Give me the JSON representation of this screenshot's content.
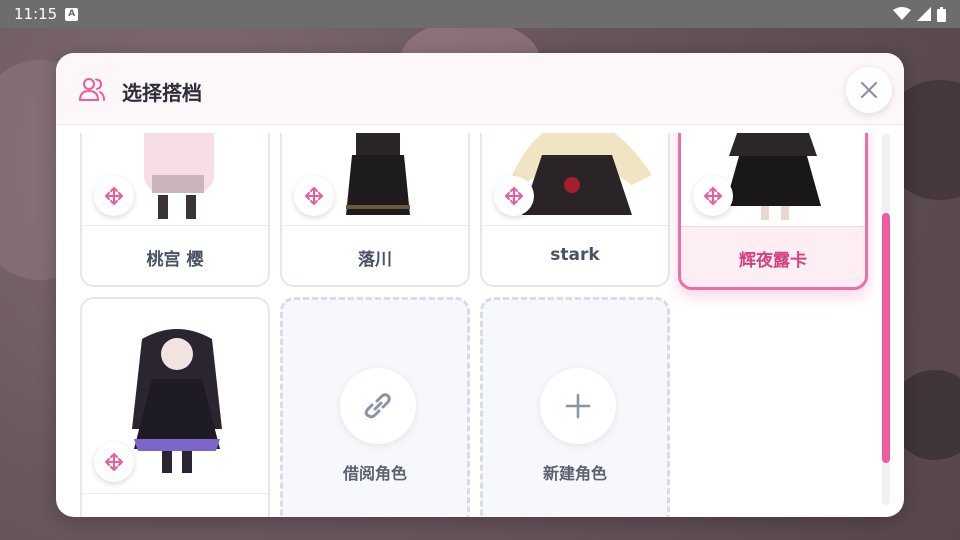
{
  "status_bar": {
    "time": "11:15",
    "notification_icon": "A"
  },
  "dialog": {
    "title": "选择搭档",
    "close_icon": "close-icon",
    "cards": [
      {
        "name": "桃宫 樱",
        "selected": false
      },
      {
        "name": "落川",
        "selected": false
      },
      {
        "name": "stark",
        "selected": false
      },
      {
        "name": "辉夜露卡",
        "selected": true
      },
      {
        "name": "",
        "selected": false
      }
    ],
    "actions": [
      {
        "label": "借阅角色",
        "icon": "link-icon"
      },
      {
        "label": "新建角色",
        "icon": "plus-icon"
      }
    ]
  },
  "colors": {
    "accent": "#ee5c9c",
    "selected_text": "#d6417f",
    "card_border": "#e3e7ee"
  }
}
